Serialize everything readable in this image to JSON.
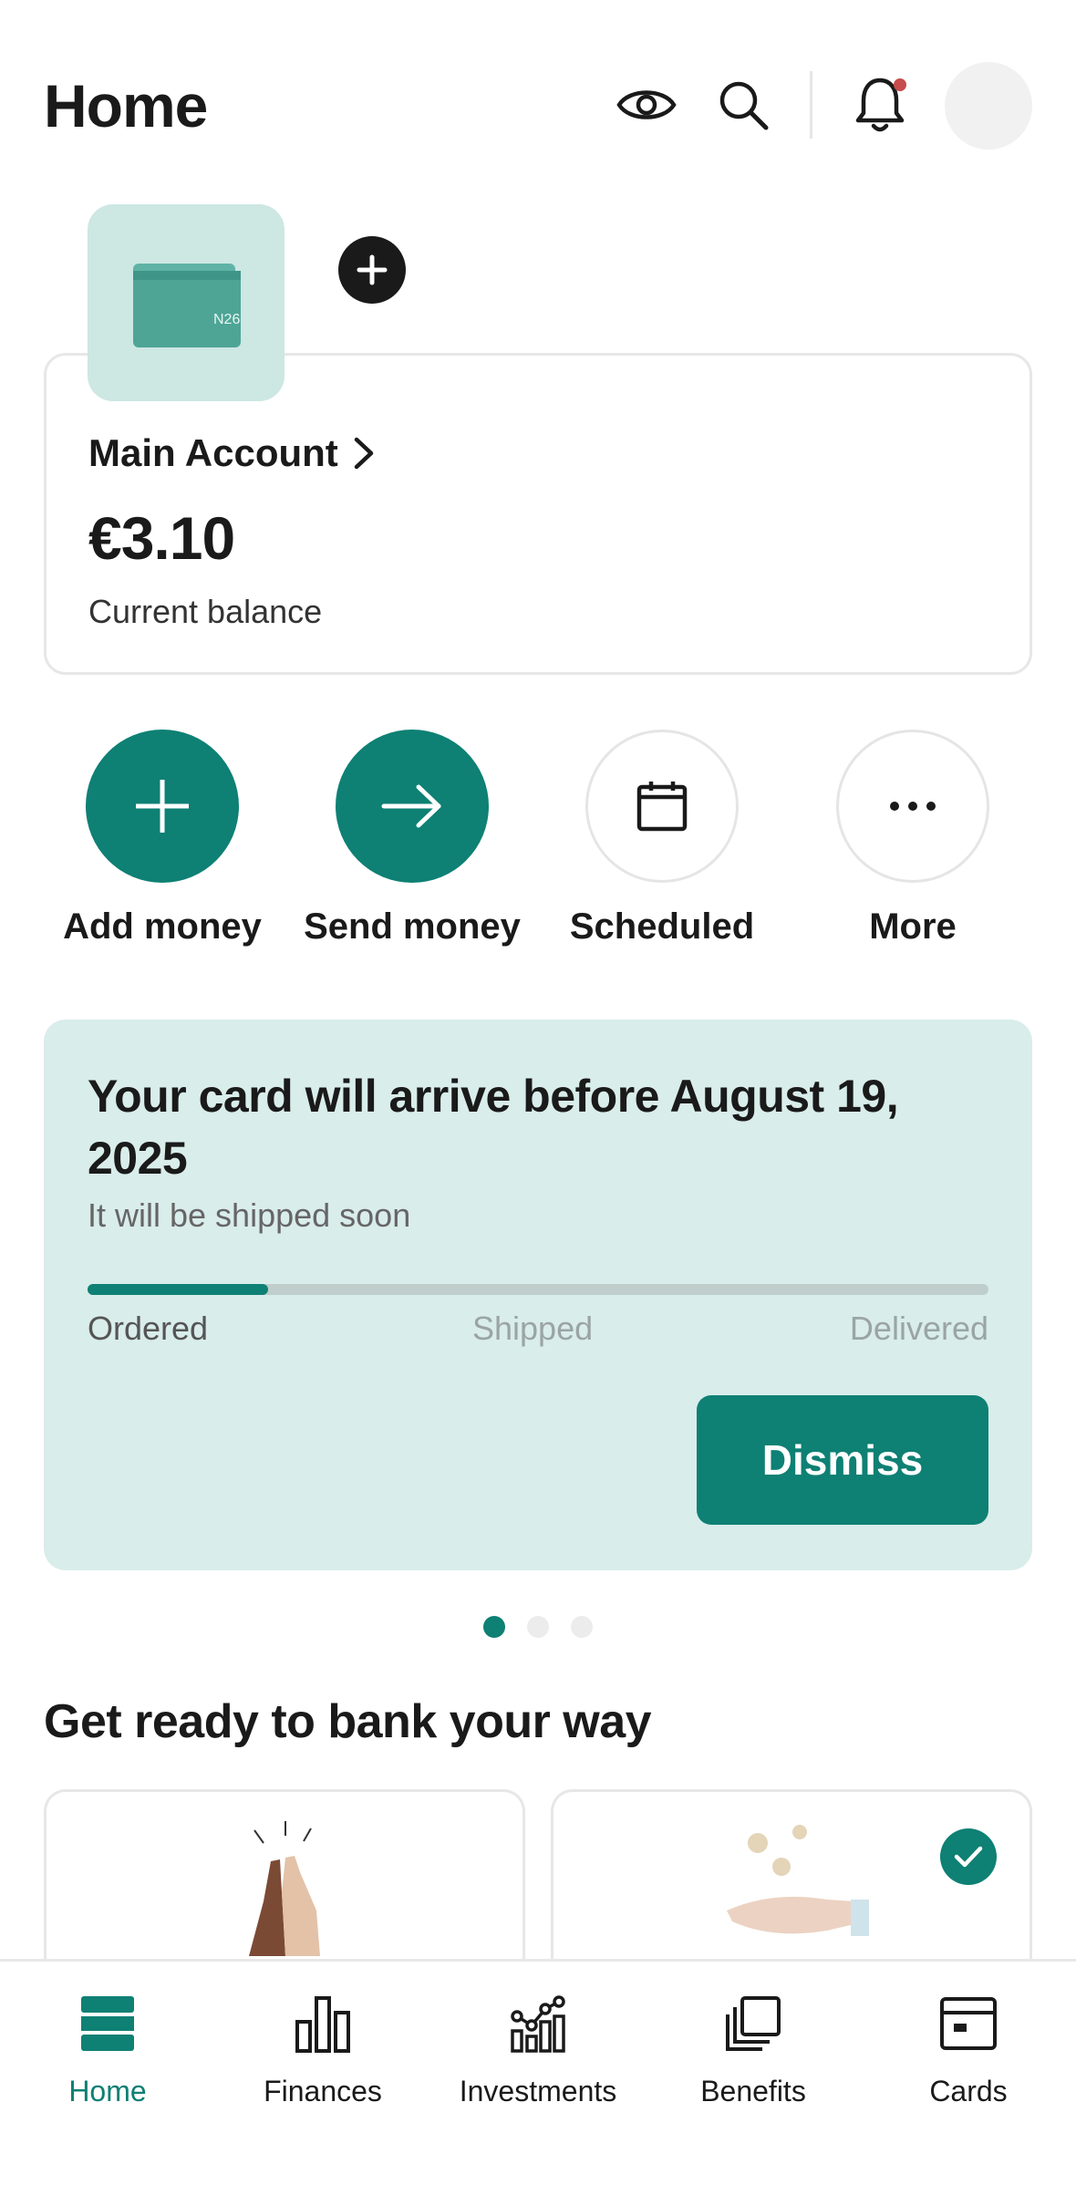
{
  "header": {
    "title": "Home",
    "icons": [
      "eye-icon",
      "search-icon",
      "bell-icon",
      "avatar"
    ]
  },
  "account": {
    "wallet_logo": "N26",
    "name": "Main Account",
    "balance": "€3.10",
    "balance_label": "Current balance"
  },
  "actions": [
    {
      "label": "Add money",
      "icon": "plus-icon"
    },
    {
      "label": "Send money",
      "icon": "arrow-right-icon"
    },
    {
      "label": "Scheduled",
      "icon": "calendar-icon"
    },
    {
      "label": "More",
      "icon": "more-icon"
    }
  ],
  "promo": {
    "title": "Your card will arrive before August 19, 2025",
    "subtitle": "It will be shipped soon",
    "progress": 0.2,
    "steps": [
      "Ordered",
      "Shipped",
      "Delivered"
    ],
    "dismiss_label": "Dismiss"
  },
  "pagination": {
    "count": 3,
    "active_index": 0
  },
  "section": {
    "title": "Get ready to bank your way"
  },
  "bottom_nav": [
    {
      "label": "Home",
      "icon": "home-icon",
      "active": true
    },
    {
      "label": "Finances",
      "icon": "bar-chart-icon",
      "active": false
    },
    {
      "label": "Investments",
      "icon": "investments-icon",
      "active": false
    },
    {
      "label": "Benefits",
      "icon": "benefits-icon",
      "active": false
    },
    {
      "label": "Cards",
      "icon": "card-icon",
      "active": false
    }
  ],
  "colors": {
    "accent": "#0e8074",
    "promo_bg": "#d9edea",
    "wallet_tile_bg": "#cde7e3",
    "notification_dot": "#c84b4b"
  }
}
